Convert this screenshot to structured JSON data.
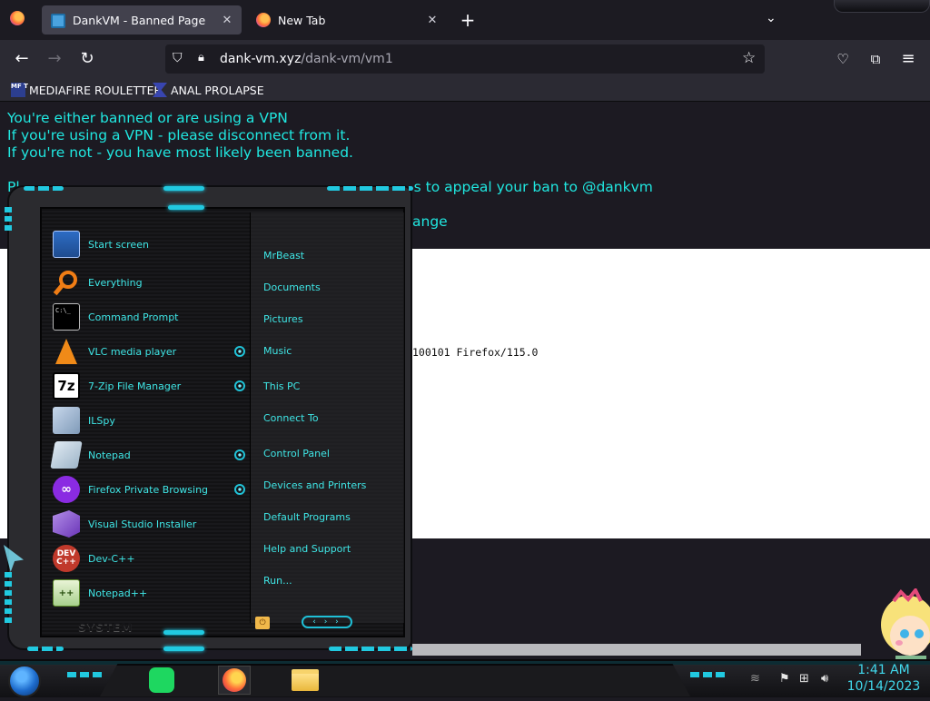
{
  "browser": {
    "tabs": [
      {
        "label": "DankVM - Banned Page",
        "icon": "monitor-icon",
        "active": true
      },
      {
        "label": "New Tab",
        "icon": "firefox-icon",
        "active": false
      }
    ],
    "new_tab_label": "+",
    "url": {
      "host": "dank-vm.xyz",
      "path": "/dank-vm/vm1"
    },
    "bookmarks": [
      {
        "label": "MEDIAFIRE ROULETTER",
        "icon": "mediafire-icon",
        "icon_text": "MF T"
      },
      {
        "label": "ANAL PROLAPSE",
        "icon": "ap-icon"
      }
    ]
  },
  "page": {
    "lines": [
      "You're either banned or are using a VPN",
      "If you're using a VPN - please disconnect from it.",
      "If you're not - you have most likely been banned."
    ],
    "appeal_visible": "s to appeal your ban to @dankvm",
    "appeal_prefix": "Pl",
    "line5_visible": "ange",
    "ua_visible": "100101 Firefox/115.0"
  },
  "start_menu": {
    "programs": [
      {
        "label": "Start screen",
        "icon": "start-screen-icon"
      },
      {
        "label": "Everything",
        "icon": "everything-icon"
      },
      {
        "label": "Command Prompt",
        "icon": "command-prompt-icon",
        "icon_text": "C:\\_"
      },
      {
        "label": "VLC media player",
        "icon": "vlc-icon"
      },
      {
        "label": "7-Zip File Manager",
        "icon": "7zip-icon",
        "icon_text": "7z"
      },
      {
        "label": "ILSpy",
        "icon": "ilspy-icon"
      },
      {
        "label": "Notepad",
        "icon": "notepad-icon"
      },
      {
        "label": "Firefox Private Browsing",
        "icon": "firefox-private-icon",
        "icon_text": "∞"
      },
      {
        "label": "Visual Studio Installer",
        "icon": "vs-installer-icon"
      },
      {
        "label": "Dev-C++",
        "icon": "devcpp-icon",
        "icon_text": "DEV C++"
      },
      {
        "label": "Notepad++",
        "icon": "notepadpp-icon",
        "icon_text": "++"
      }
    ],
    "links": [
      "MrBeast",
      "Documents",
      "Pictures",
      "Music",
      "This PC",
      "Connect To",
      "Control Panel",
      "Devices and Printers",
      "Default Programs",
      "Help and Support",
      "Run..."
    ],
    "system_label": "SYSTEM",
    "nav_arrows": "‹ › ›"
  },
  "taskbar": {
    "apps": [
      "spotify-icon",
      "firefox-icon",
      "file-explorer-icon"
    ],
    "clock": {
      "time": "1:41 AM",
      "date": "10/14/2023"
    }
  },
  "colors": {
    "page_text": "#20e7e0",
    "menu_text": "#3fe6e6",
    "accent": "#21c9e0",
    "clock": "#41d8ec"
  }
}
